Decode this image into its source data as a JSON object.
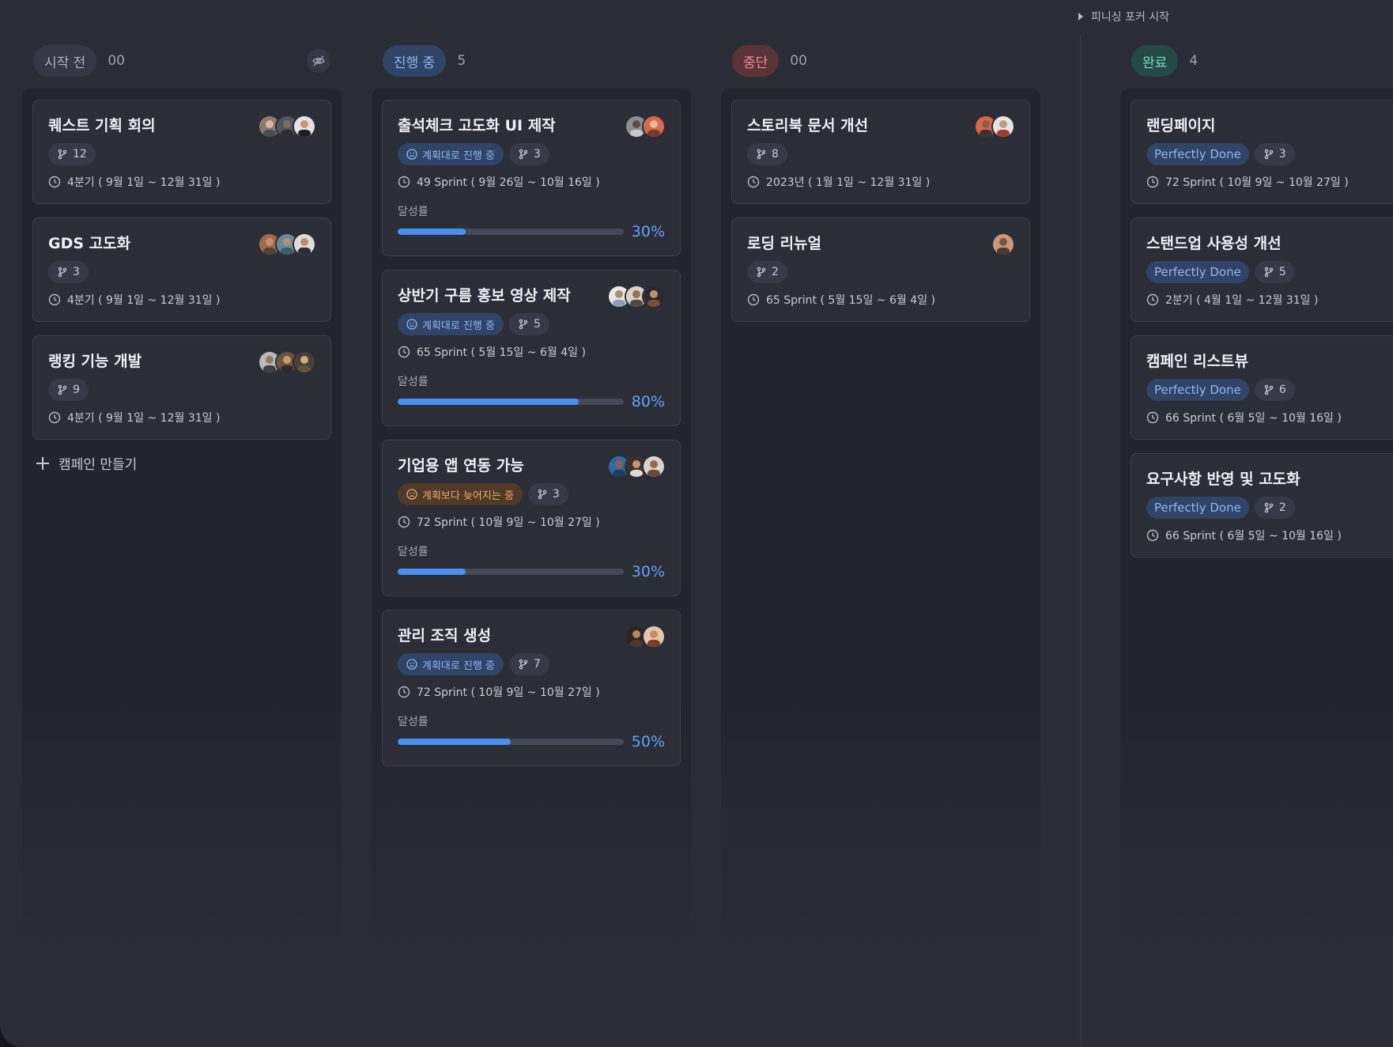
{
  "topbar": {
    "planning_poker_label": "피니싱 포커 시작"
  },
  "columns": [
    {
      "label": "시작 전",
      "count": "00",
      "create_label": "캠페인 만들기",
      "cards": [
        {
          "title": "퀘스트 기획 회의",
          "git": "12",
          "period": "4분기 ( 9월 1일 ~ 12월 31일 )"
        },
        {
          "title": "GDS 고도화",
          "git": "3",
          "period": "4분기 ( 9월 1일 ~ 12월 31일 )"
        },
        {
          "title": "랭킹 기능 개발",
          "git": "9",
          "period": "4분기 ( 9월 1일 ~ 12월 31일 )"
        }
      ]
    },
    {
      "label": "진행 중",
      "count": "5",
      "progress_label": "달성률",
      "cards": [
        {
          "title": "출석체크 고도화 UI 제작",
          "status": "계획대로 진행 중",
          "git": "3",
          "period": "49 Sprint ( 9월 26일 ~ 10월 16일 )",
          "progress": 0.3,
          "pct": "30%"
        },
        {
          "title": "상반기 구름 홍보 영상 제작",
          "status": "계획대로 진행 중",
          "git": "5",
          "period": "65 Sprint ( 5월 15일 ~ 6월 4일 )",
          "progress": 0.8,
          "pct": "80%"
        },
        {
          "title": "기업용 앱 연동 가능",
          "status": "계획보다 늦어지는 중",
          "git": "3",
          "period": "72 Sprint ( 10월 9일 ~ 10월 27일 )",
          "progress": 0.3,
          "pct": "30%"
        },
        {
          "title": "관리 조직 생성",
          "status": "계획대로 진행 중",
          "git": "7",
          "period": "72 Sprint ( 10월 9일 ~ 10월 27일 )",
          "progress": 0.5,
          "pct": "50%"
        }
      ]
    },
    {
      "label": "중단",
      "count": "00",
      "cards": [
        {
          "title": "스토리북 문서 개선",
          "git": "8",
          "period": "2023년 ( 1월 1일 ~ 12월 31일 )"
        },
        {
          "title": "로딩 리뉴얼",
          "git": "2",
          "period": "65 Sprint ( 5월 15일 ~ 6월 4일 )"
        }
      ]
    },
    {
      "label": "완료",
      "count": "4",
      "cards": [
        {
          "title": "랜딩페이지",
          "status": "Perfectly Done",
          "git": "3",
          "period": "72 Sprint ( 10월 9일 ~ 10월 27일 )"
        },
        {
          "title": "스탠드업 사용성 개선",
          "status": "Perfectly Done",
          "git": "5",
          "period": "2분기 ( 4월 1일 ~ 12월 31일 )"
        },
        {
          "title": "캠페인 리스트뷰",
          "status": "Perfectly Done",
          "git": "6",
          "period": "66 Sprint ( 6월 5일 ~ 10월 16일 )"
        },
        {
          "title": "요구사항 반영 및 고도화",
          "status": "Perfectly Done",
          "git": "2",
          "period": "66 Sprint ( 6월 5일 ~ 10월 16일 )"
        }
      ]
    }
  ],
  "icons": {
    "git": "git-branch-icon",
    "clock": "clock-icon",
    "plan": "smile-icon",
    "late": "frown-icon",
    "hide": "eye-off-icon",
    "plus": "plus-icon",
    "caret": "caret-right-icon"
  },
  "colors": {
    "accent": "#4a8ef0",
    "late": "#f3a76a",
    "stop": "#f09098",
    "done": "#7fd8c0"
  }
}
